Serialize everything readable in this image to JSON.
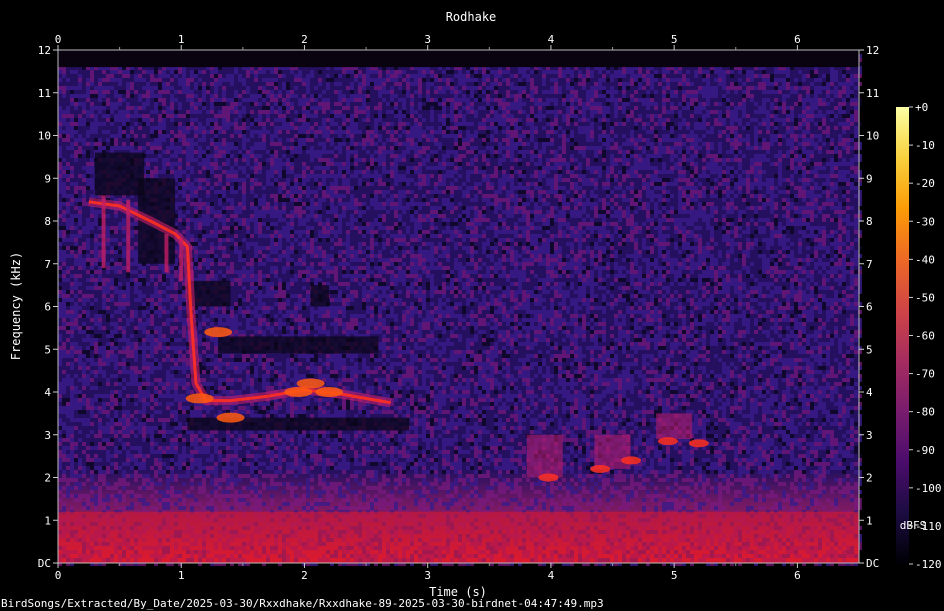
{
  "chart_data": {
    "type": "heatmap",
    "title": "Rodhake",
    "xlabel": "Time (s)",
    "ylabel": "Frequency (kHz)",
    "colorbar_label": "dBFS",
    "xlim": [
      0,
      6.5
    ],
    "ylim": [
      0,
      12
    ],
    "x_ticks": [
      "0",
      "1",
      "2",
      "3",
      "4",
      "5",
      "6"
    ],
    "y_ticks": [
      "DC",
      "1",
      "2",
      "3",
      "4",
      "5",
      "6",
      "7",
      "8",
      "9",
      "10",
      "11",
      "12"
    ],
    "colorbar_range": [
      -120,
      0
    ],
    "colorbar_ticks": [
      "+0",
      "-10",
      "-20",
      "-30",
      "-40",
      "-50",
      "-60",
      "-70",
      "-80",
      "-90",
      "-100",
      "-110",
      "-120"
    ],
    "colormap": [
      "#000004",
      "#1b0c41",
      "#4a0c6b",
      "#781c6d",
      "#a52c60",
      "#cf4446",
      "#ed6925",
      "#fb9b06",
      "#f7d13d",
      "#fcffa4"
    ],
    "footer": "BirdSongs/Extracted/By_Date/2025-03-30/Rxxdhake/Rxxdhake-89-2025-03-30-birdnet-04:47:49.mp3"
  }
}
